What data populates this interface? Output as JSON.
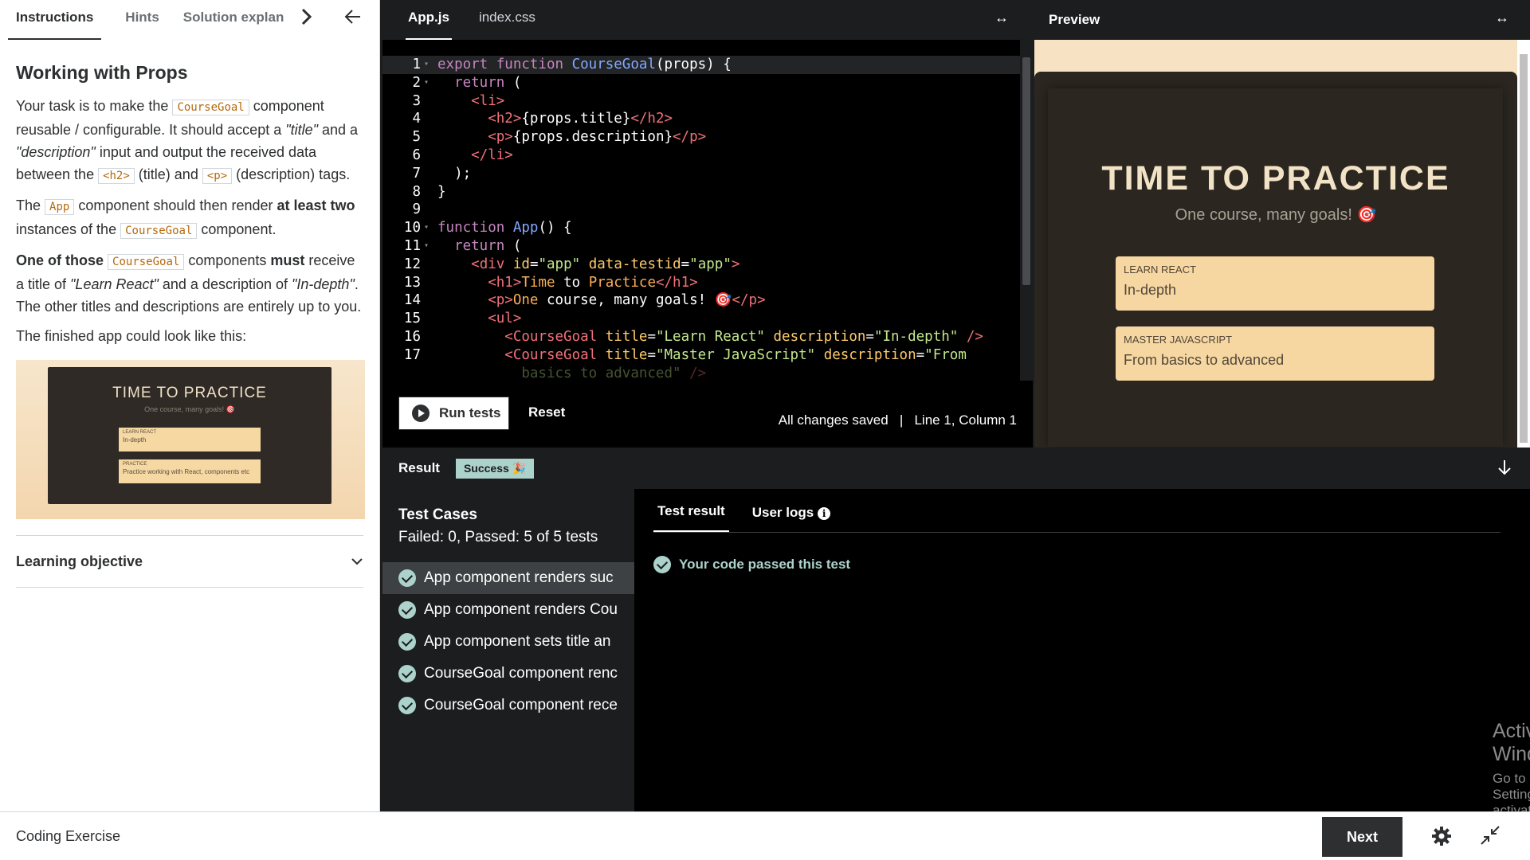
{
  "left": {
    "tabs": [
      "Instructions",
      "Hints",
      "Solution explan"
    ],
    "title": "Working with Props",
    "para1": {
      "a": "Your task is to make the ",
      "code1": "CourseGoal",
      "b": " component reusable / configurable. It should accept a ",
      "c": "\"title\"",
      "d": " and a ",
      "e": "\"description\"",
      "f": " input and output the received data between the ",
      "code2": "<h2>",
      "g": " (title) and ",
      "code3": "<p>",
      "h": " (description) tags."
    },
    "para2": {
      "a": "The ",
      "code1": "App",
      "b": " component should then render ",
      "bold": "at least two",
      "c": " instances of the ",
      "code2": "CourseGoal",
      "d": " component."
    },
    "para3": {
      "bold1": "One of those",
      "code1": "CourseGoal",
      "a": " components ",
      "bold2": "must",
      "b": " receive a title of ",
      "i1": "\"Learn React\"",
      "c": " and a description of ",
      "i2": "\"In-depth\"",
      "d": ". The other titles and descriptions are entirely up to you."
    },
    "para4": "The finished app could look like this:",
    "preview_img": {
      "title": "TIME TO PRACTICE",
      "subtitle": "One course, many goals! 🎯",
      "goal1_title": "LEARN REACT",
      "goal1_desc": "In-depth",
      "goal2_title": "PRACTICE",
      "goal2_desc": "Practice working with React, components etc"
    },
    "learning_objective": "Learning objective"
  },
  "editor": {
    "tabs": [
      "App.js",
      "index.css"
    ],
    "run_label": "Run tests",
    "reset_label": "Reset",
    "status": "All changes saved   |   Line 1, Column 1"
  },
  "preview": {
    "label": "Preview",
    "title": "TIME TO PRACTICE",
    "subtitle": "One course, many goals! 🎯",
    "goals": [
      {
        "title": "LEARN REACT",
        "desc": "In-depth"
      },
      {
        "title": "MASTER JAVASCRIPT",
        "desc": "From basics to advanced"
      }
    ]
  },
  "result": {
    "label": "Result",
    "badge": "Success 🎉",
    "test_cases_title": "Test Cases",
    "summary": "Failed: 0, Passed: 5 of 5 tests",
    "tests": [
      "App component renders suc",
      "App component renders Cou",
      "App component sets title an",
      "CourseGoal component renc",
      "CourseGoal component rece"
    ],
    "detail_tabs": [
      "Test result",
      "User logs"
    ],
    "passed_msg": "Your code passed this test"
  },
  "watermark": {
    "line1": "Activate Windows",
    "line2": "Go to Settings to activate Windows."
  },
  "footer": {
    "label": "Coding Exercise",
    "next_label": "Next"
  },
  "colors": {
    "accent_success": "#acd2cc",
    "preview_bg": "#f8e2c4",
    "goal_bg": "#f7d7a1"
  }
}
